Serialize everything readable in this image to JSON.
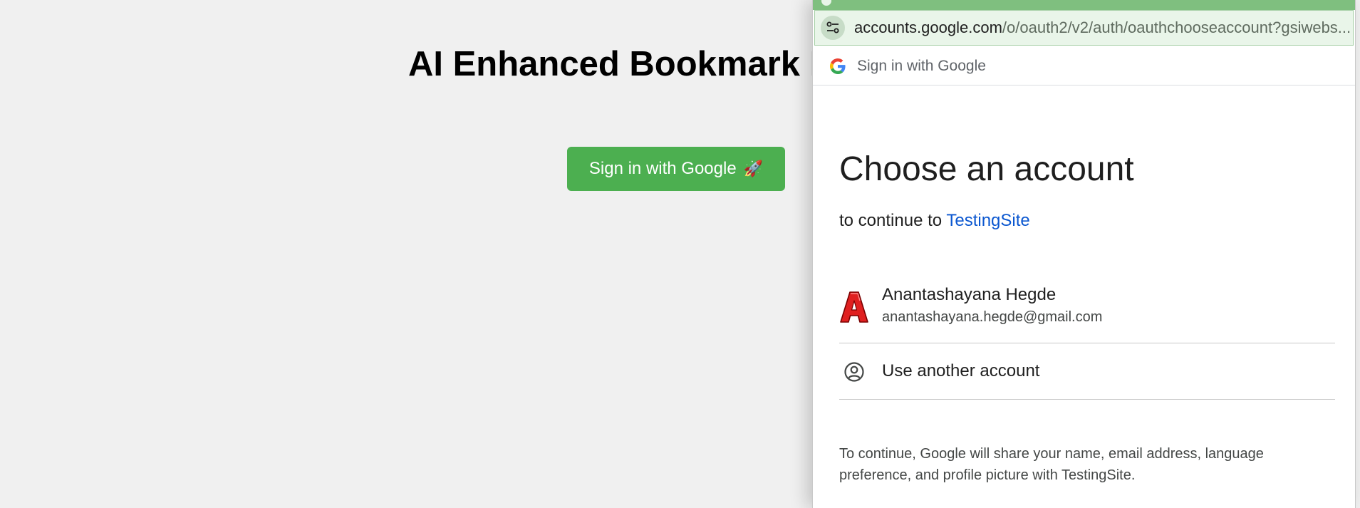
{
  "app": {
    "title": "AI Enhanced Bookmark M",
    "signin_button_label": "Sign in with Google",
    "signin_button_emoji": "🚀"
  },
  "popup": {
    "url_domain": "accounts.google.com",
    "url_path": "/o/oauth2/v2/auth/oauthchooseaccount?gsiwebs...",
    "header_title": "Sign in with Google",
    "heading": "Choose an account",
    "continue_prefix": "to continue to",
    "site_name": "TestingSite",
    "account": {
      "name": "Anantashayana Hegde",
      "email": "anantashayana.hegde@gmail.com",
      "avatar_letter": "A"
    },
    "use_another_label": "Use another account",
    "disclaimer": "To continue, Google will share your name, email address, language preference, and profile picture with TestingSite."
  },
  "colors": {
    "signin_button": "#4caf50",
    "link_blue": "#0b57d0",
    "popup_titlebar": "#7fbf7f",
    "urlbar_bg": "#e9f5e9",
    "avatar_red": "#e02020"
  },
  "icons": {
    "url_icon": "tune-settings-icon",
    "header_logo": "google-g-icon",
    "another_account_icon": "account-circle-icon"
  }
}
